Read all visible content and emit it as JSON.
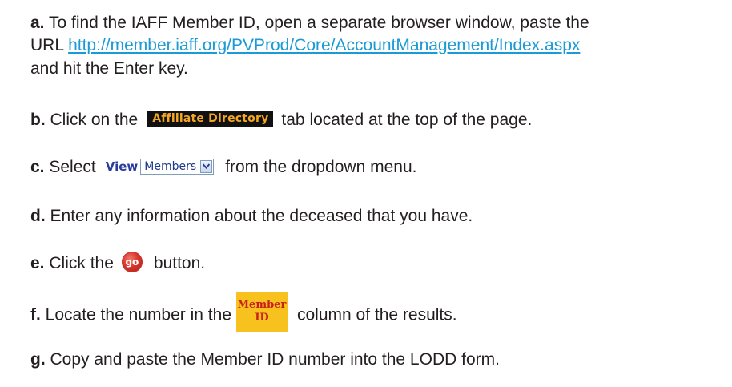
{
  "steps": {
    "a": {
      "letter": "a.",
      "text_before_link": "To find the IAFF Member ID, open a separate browser window, paste the",
      "url_prefix": "URL ",
      "link": "http://member.iaff.org/PVProd/Core/AccountManagement/Index.aspx",
      "text_after": "and hit the Enter key."
    },
    "b": {
      "letter": "b.",
      "text_before": "Click on the",
      "tab_label": "Affiliate Directory",
      "text_after": "tab located at the top of the page."
    },
    "c": {
      "letter": "c.",
      "text_before": "Select",
      "view_label": "View",
      "select_value": "Members",
      "text_after": "from the dropdown menu."
    },
    "d": {
      "letter": "d.",
      "text": "Enter any information about the deceased that you have."
    },
    "e": {
      "letter": "e.",
      "text_before": "Click the",
      "button_label": "go",
      "text_after": "button."
    },
    "f": {
      "letter": "f.",
      "text_before": "Locate the number in the",
      "column_header_line1": "Member",
      "column_header_line2": "ID",
      "text_after": "column of the results."
    },
    "g": {
      "letter": "g.",
      "text": "Copy and paste the Member ID number into the LODD form."
    }
  },
  "colors": {
    "text": "#231f20",
    "link": "#1a9ad6",
    "tab_bg": "#111111",
    "tab_text": "#f5a623",
    "view_text": "#2a3d9c",
    "go_button": "#d8342a",
    "member_header_bg": "#f7c21e",
    "member_header_text": "#c8201c"
  },
  "icons": {
    "select_arrow": "chevron-down-icon",
    "go_button": "go-button-icon"
  }
}
